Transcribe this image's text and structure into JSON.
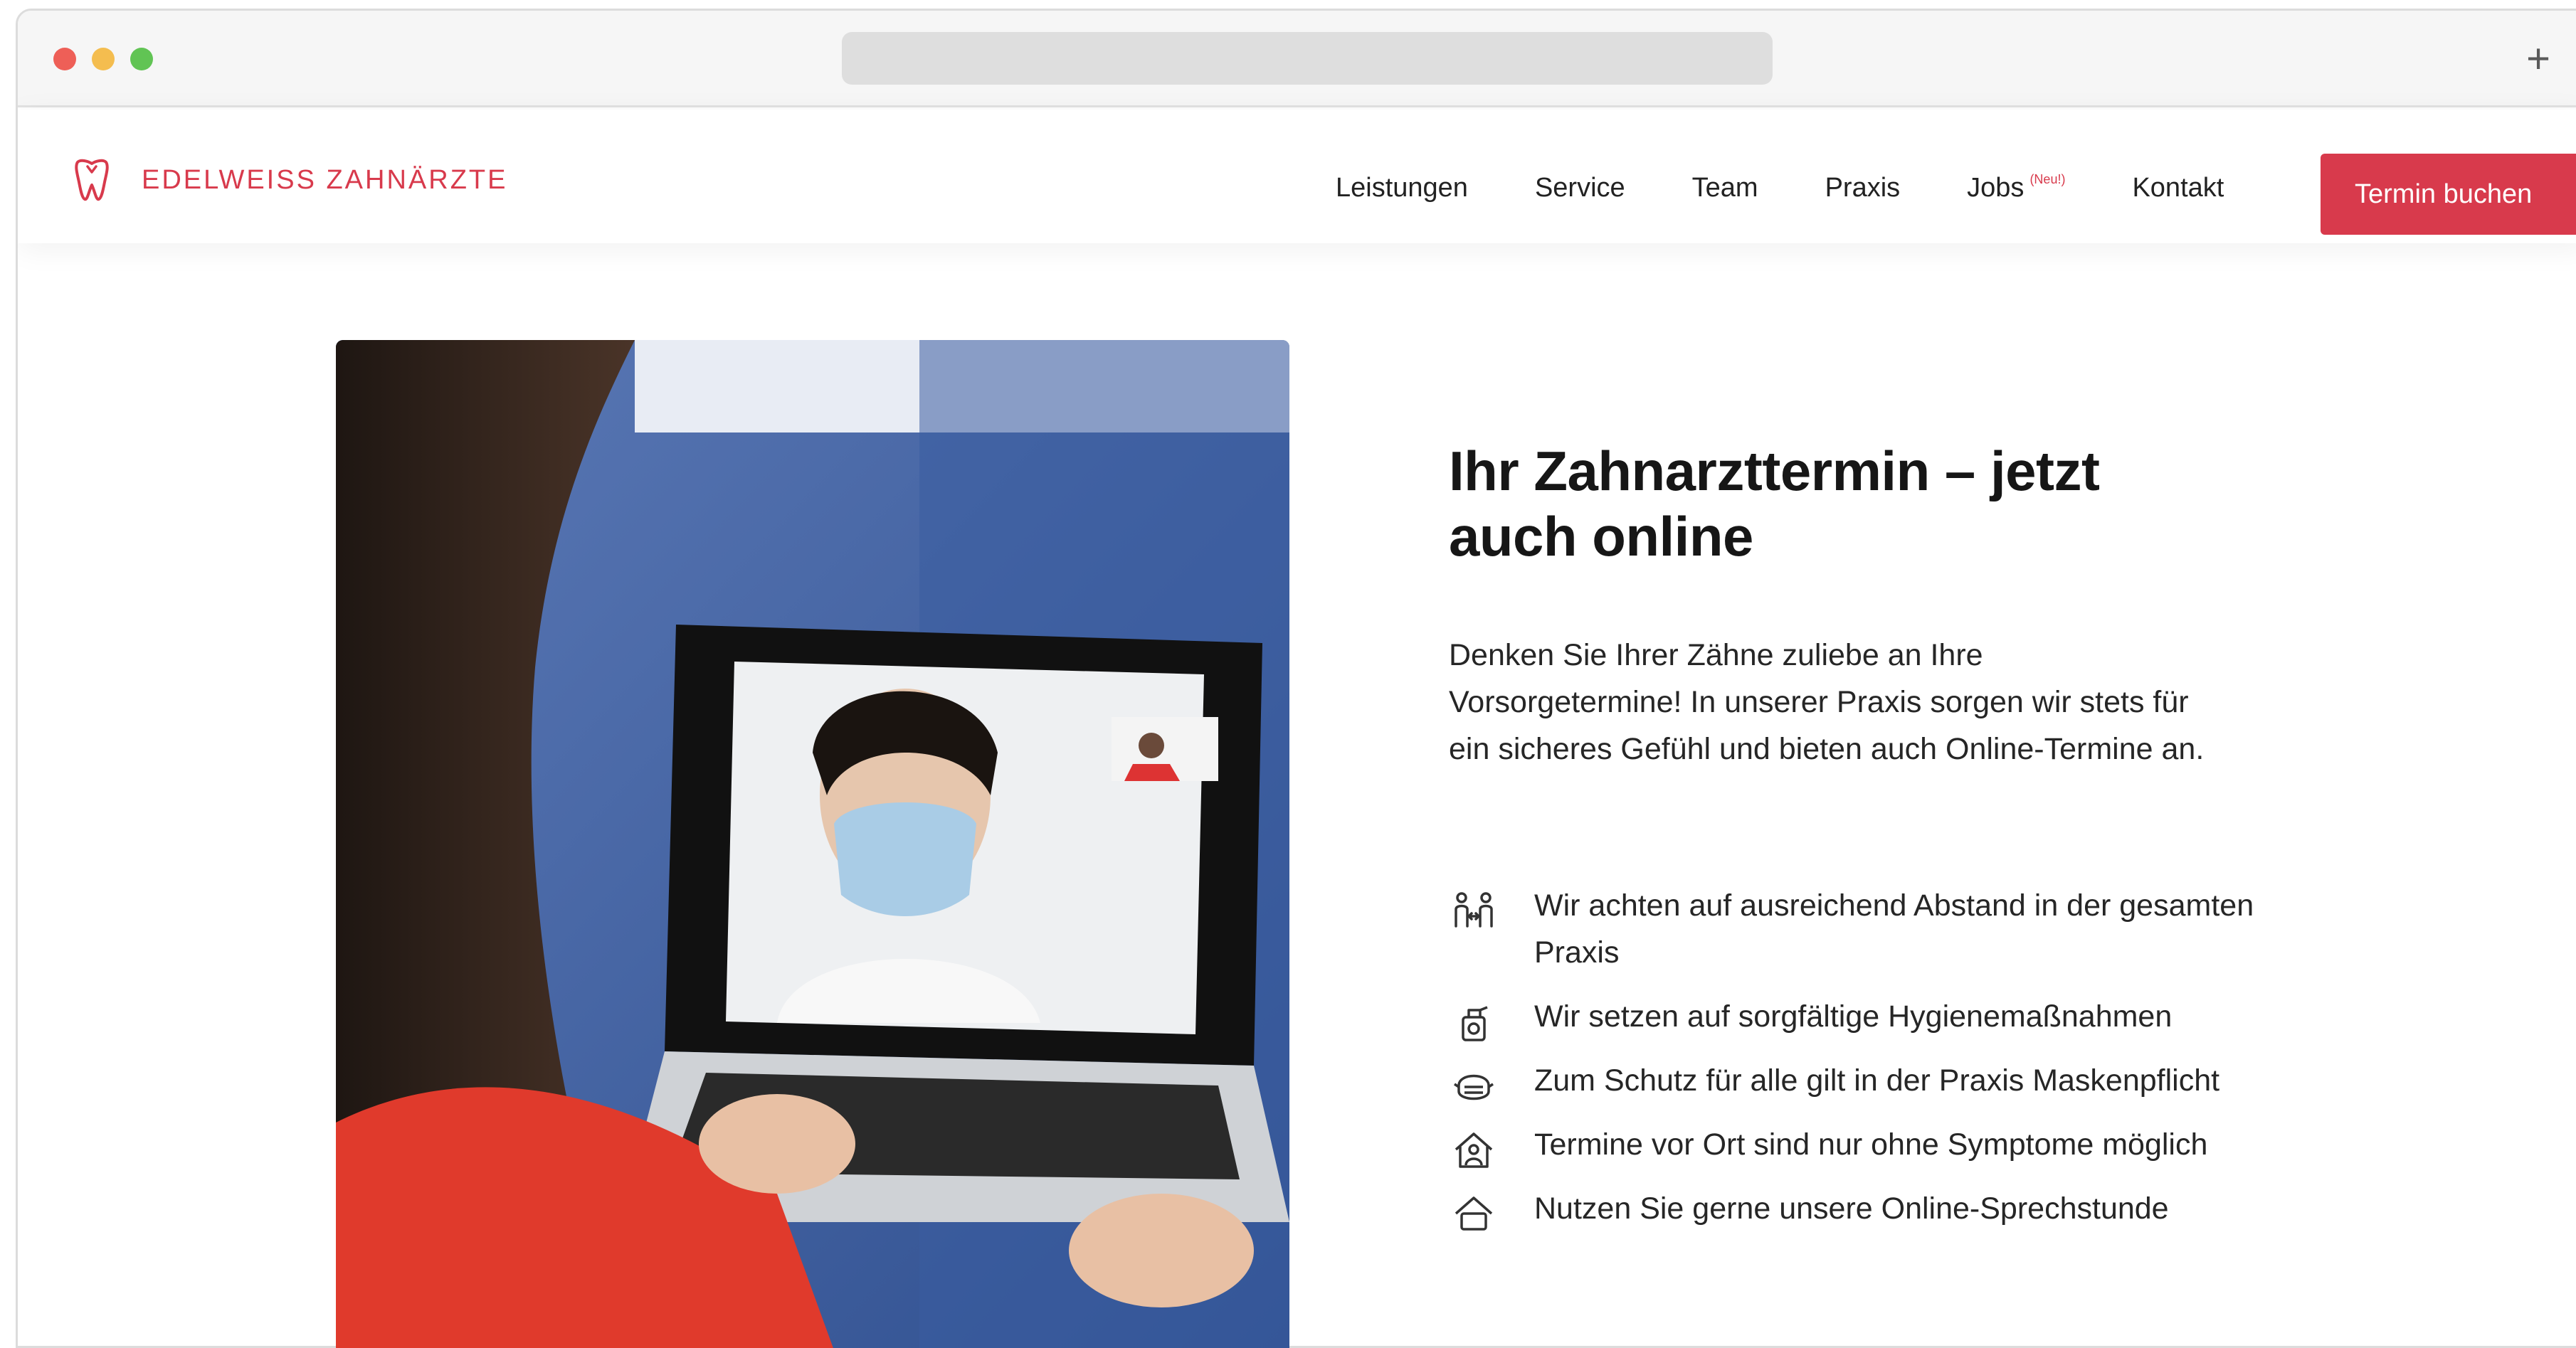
{
  "browser": {
    "new_tab_glyph": "+"
  },
  "header": {
    "logo_text": "EDELWEISS ZAHNÄRZTE",
    "logo_icon": "tooth-icon",
    "nav": [
      {
        "label": "Leistungen"
      },
      {
        "label": "Service"
      },
      {
        "label": "Team"
      },
      {
        "label": "Praxis"
      },
      {
        "label": "Jobs",
        "badge": "(Neu!)"
      },
      {
        "label": "Kontakt"
      }
    ],
    "cta_label": "Termin buchen",
    "accent_color": "#d83a4c"
  },
  "main": {
    "headline": "Ihr Zahnarzttermin – jetzt auch online",
    "intro": "Denken Sie Ihrer Zähne zuliebe an Ihre Vorsorgetermine! In unserer Praxis sorgen wir stets für ein sicheres Gefühl und bieten auch Online-Termine an.",
    "features": [
      {
        "icon": "distance-icon",
        "text": "Wir achten auf ausreichend Abstand in der gesamten Praxis"
      },
      {
        "icon": "disinfectant-icon",
        "text": "Wir setzen auf sorgfältige Hygienemaßnahmen"
      },
      {
        "icon": "mask-icon",
        "text": "Zum Schutz für alle gilt in der Praxis Maskenpflicht"
      },
      {
        "icon": "home-person-icon",
        "text": "Termine vor Ort sind nur ohne Symptome möglich"
      },
      {
        "icon": "video-consult-icon",
        "text": "Nutzen Sie gerne unsere Online-Sprechstunde"
      }
    ]
  }
}
